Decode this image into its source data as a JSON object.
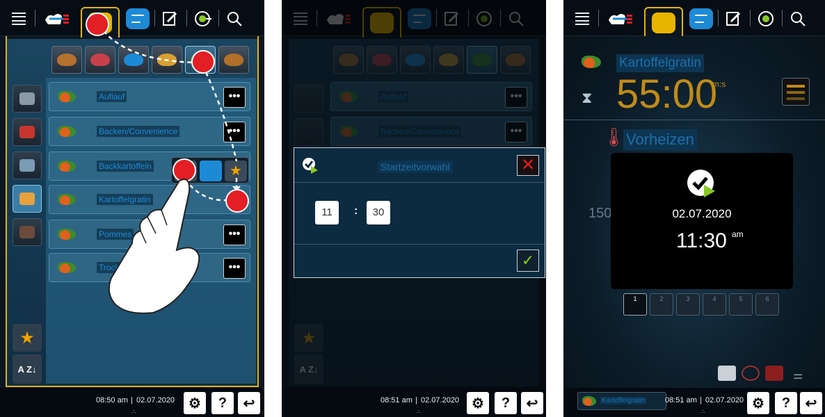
{
  "screen1": {
    "list_rows": [
      {
        "label": "Auflauf"
      },
      {
        "label": "Backen/Convenience"
      },
      {
        "label": "Backkartoffeln"
      },
      {
        "label": "Kartoffelgratin"
      },
      {
        "label": "Pommes"
      },
      {
        "label": "Trockne"
      }
    ],
    "more_label": "•••",
    "sort_label": "A Z↓",
    "footer": {
      "time": "08:50 am",
      "date": "02.07.2020"
    }
  },
  "screen2": {
    "dialog": {
      "title": "Startzeitvorwahl",
      "hours": "11",
      "minutes": "30",
      "separator": ":",
      "close_symbol": "✕",
      "confirm_symbol": "✓"
    },
    "background_rows": [
      {
        "label": "Auflauf"
      },
      {
        "label": "Backen/Convenience"
      }
    ],
    "footer": {
      "time": "08:51 am",
      "date": "02.07.2020"
    }
  },
  "screen3": {
    "recipe_title": "Kartoffelgratin",
    "timer": "55:00",
    "timer_unit": "m:s",
    "phase_label": "Vorheizen",
    "temperature_partial": "150",
    "overlay": {
      "date": "02.07.2020",
      "time": "11:30",
      "meridiem": "am"
    },
    "steps": [
      "1",
      "2",
      "3",
      "4",
      "5",
      "6"
    ],
    "bottom_recipe": "Kartoffelgratin",
    "footer": {
      "time": "08:51 am",
      "date": "02.07.2020"
    }
  },
  "footer_common": {
    "question": "?",
    "separator": "|"
  },
  "colors": {
    "accent_gold": "#e7b400",
    "highlight_red": "#e31e24",
    "brand_blue": "#1d8ad6",
    "confirm_green": "#8ac926",
    "timer_amber": "#c08a1a"
  },
  "icons": [
    "menu-icon",
    "cooking-modes-icon",
    "chef-hat-icon",
    "programs-icon",
    "edit-icon",
    "icarecycle-icon",
    "search-icon",
    "star-icon",
    "settings-icon",
    "help-icon",
    "back-icon",
    "hourglass-icon",
    "thermometer-icon",
    "clock-check-icon"
  ]
}
